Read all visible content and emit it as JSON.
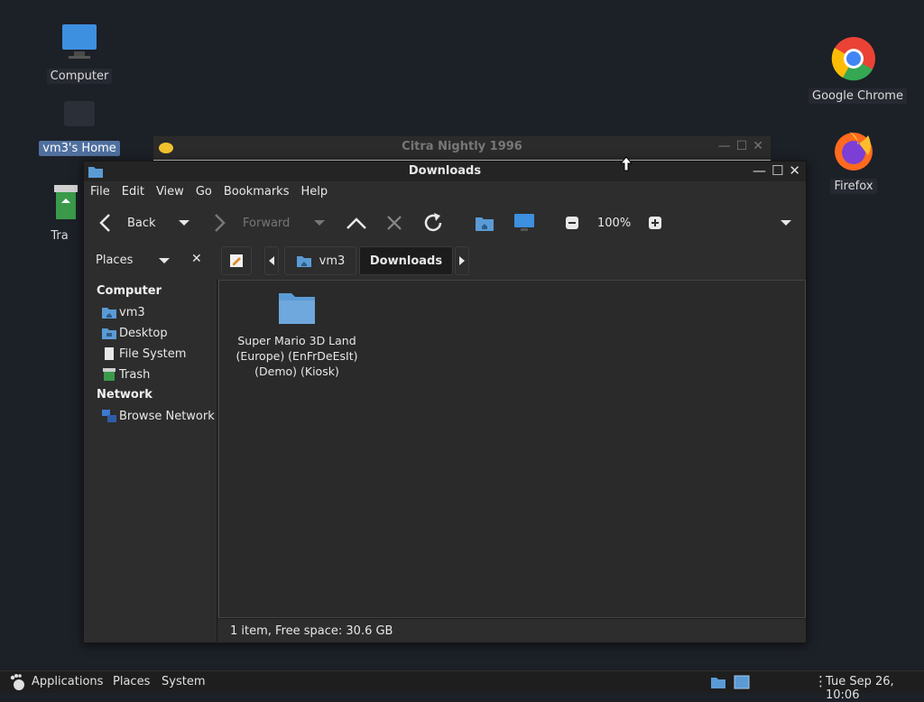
{
  "desktop": {
    "icons": {
      "computer": "Computer",
      "home": "vm3's Home",
      "trash": "Tra",
      "chrome": "Google Chrome",
      "firefox": "Firefox"
    }
  },
  "citra": {
    "title": "Citra Nightly 1996"
  },
  "window": {
    "title": "Downloads",
    "menu": [
      "File",
      "Edit",
      "View",
      "Go",
      "Bookmarks",
      "Help"
    ],
    "toolbar": {
      "back": "Back",
      "forward": "Forward",
      "zoom": "100%"
    },
    "places_label": "Places",
    "breadcrumbs": [
      "vm3",
      "Downloads"
    ],
    "sidebar": {
      "computer_header": "Computer",
      "computer_items": [
        "vm3",
        "Desktop",
        "File System",
        "Trash"
      ],
      "network_header": "Network",
      "network_items": [
        "Browse Network"
      ]
    },
    "files": [
      {
        "name": "Super Mario 3D Land (Europe) (EnFrDeEsIt) (Demo) (Kiosk)"
      }
    ],
    "status": "1 item, Free space: 30.6 GB"
  },
  "taskbar": {
    "applications": "Applications",
    "places": "Places",
    "system": "System",
    "clock": "Tue Sep 26, 10:06"
  },
  "colors": {
    "folder": "#5b9bd5",
    "accent": "#4f6f9e",
    "chrome_red": "#ea4335"
  }
}
